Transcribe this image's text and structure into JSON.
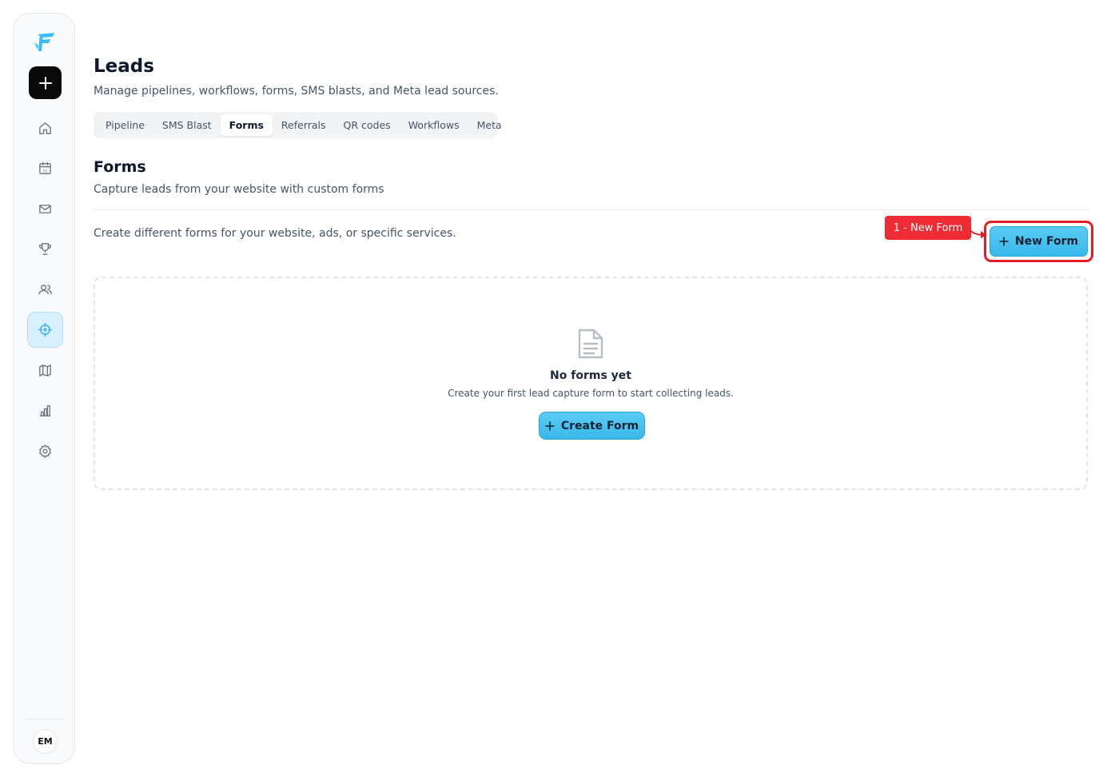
{
  "sidebar": {
    "avatar_initials": "EM",
    "nav": [
      "home-icon",
      "calendar-icon",
      "mail-icon",
      "trophy-icon",
      "users-icon",
      "crosshair-icon",
      "map-icon",
      "bar-chart-icon",
      "gear-icon"
    ],
    "active": "crosshair-icon",
    "accent": "#d7f0fb"
  },
  "header": {
    "title": "Leads",
    "subtitle": "Manage pipelines, workflows, forms, SMS blasts, and Meta lead sources."
  },
  "tabs": [
    {
      "label": "Pipeline",
      "active": false
    },
    {
      "label": "SMS Blast",
      "active": false
    },
    {
      "label": "Forms",
      "active": true
    },
    {
      "label": "Referrals",
      "active": false
    },
    {
      "label": "QR codes",
      "active": false
    },
    {
      "label": "Workflows",
      "active": false
    },
    {
      "label": "Meta",
      "active": false
    }
  ],
  "forms": {
    "title": "Forms",
    "subtitle": "Capture leads from your website with custom forms",
    "description": "Create different forms for your website, ads, or specific services.",
    "new_form_label": "New Form",
    "empty_title": "No forms yet",
    "empty_subtitle": "Create your first lead capture form to start collecting leads.",
    "create_form_label": "Create Form"
  },
  "annotation": {
    "label": "1 - New Form",
    "color": "#ef2b34"
  },
  "colors": {
    "primary_button": "#38b8ea"
  }
}
